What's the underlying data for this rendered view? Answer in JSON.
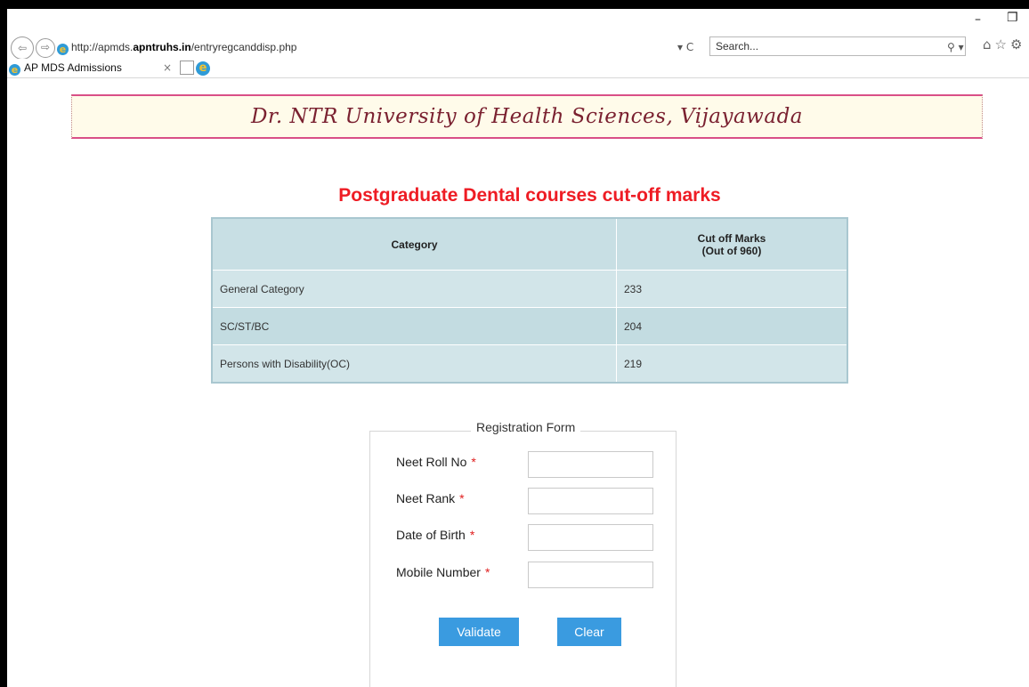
{
  "window": {
    "minimize_glyph": "–",
    "restore_glyph": "❐"
  },
  "browser": {
    "back_glyph": "⇦",
    "forward_glyph": "⇨",
    "address_prefix": "http://apmds.",
    "address_host": "apntruhs.in",
    "address_path": "/entryregcanddisp.php",
    "address_controls": "▾ C",
    "search_placeholder": "Search...",
    "search_controls": "⚲ ▾",
    "toolbar_icons": "⌂☆⚙",
    "tab_title": "AP MDS Admissions",
    "tab_close": "×",
    "ie_glyph": "e"
  },
  "page": {
    "banner_title": "Dr. NTR University of Health Sciences, Vijayawada",
    "cutoff_title": "Postgraduate Dental courses cut-off marks",
    "table": {
      "headers": [
        "Category",
        "Cut off Marks",
        "(Out of 960)"
      ],
      "rows": [
        {
          "category": "General Category",
          "marks": "233"
        },
        {
          "category": "SC/ST/BC",
          "marks": "204"
        },
        {
          "category": "Persons with Disability(OC)",
          "marks": "219"
        }
      ]
    },
    "form": {
      "legend": "Registration Form",
      "required_mark": "*",
      "fields": [
        {
          "label": "Neet Roll No",
          "value": ""
        },
        {
          "label": "Neet Rank",
          "value": ""
        },
        {
          "label": "Date of Birth",
          "value": ""
        },
        {
          "label": "Mobile Number",
          "value": ""
        }
      ],
      "validate_label": "Validate",
      "clear_label": "Clear"
    }
  },
  "colors": {
    "title_red": "#ee1c24",
    "banner_text": "#7a2130",
    "banner_border": "#d94f87",
    "button_blue": "#3a9be0",
    "table_header": "#c8dfe4"
  }
}
